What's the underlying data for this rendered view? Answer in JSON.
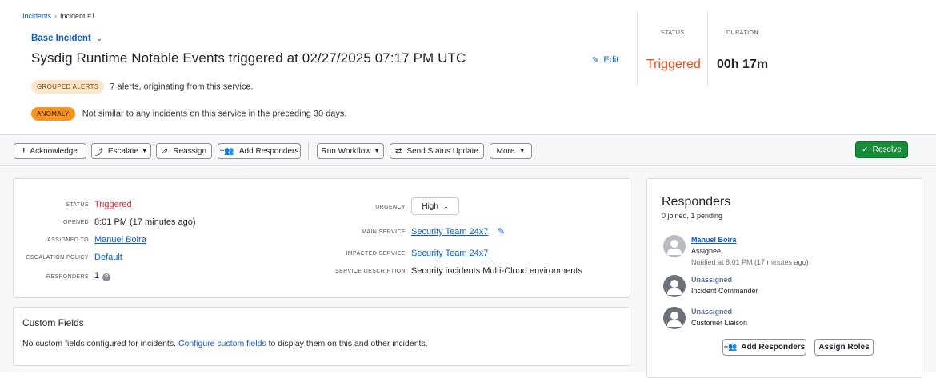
{
  "breadcrumb": {
    "root": "Incidents",
    "separator": "›",
    "current": "Incident #1"
  },
  "header": {
    "base_incident": "Base Incident",
    "title": "Sysdig Runtime Notable Events triggered at 02/27/2025 07:17 PM UTC",
    "edit_label": "Edit",
    "grouped_pill": "GROUPED ALERTS",
    "grouped_text": "7 alerts, originating from this service.",
    "anomaly_pill": "ANOMALY",
    "anomaly_text": "Not similar to any incidents on this service in the preceding 30 days.",
    "status_label": "STATUS",
    "status_value": "Triggered",
    "duration_label": "DURATION",
    "duration_value": "00h 17m"
  },
  "toolbar": {
    "acknowledge": "Acknowledge",
    "escalate": "Escalate",
    "reassign": "Reassign",
    "add_responders": "Add Responders",
    "run_workflow": "Run Workflow",
    "send_status_update": "Send Status Update",
    "more": "More",
    "resolve": "Resolve"
  },
  "details": {
    "status_label": "STATUS",
    "status_value": "Triggered",
    "opened_label": "OPENED",
    "opened_value": "8:01 PM (17 minutes ago)",
    "assigned_label": "ASSIGNED TO",
    "assigned_value": "Manuel Boira",
    "escalation_label": "ESCALATION POLICY",
    "escalation_value": "Default",
    "responders_label": "RESPONDERS",
    "responders_value": "1",
    "urgency_label": "URGENCY",
    "urgency_value": "High",
    "main_service_label": "MAIN SERVICE",
    "main_service_value": "Security Team 24x7",
    "impacted_label": "IMPACTED SERVICE",
    "impacted_value": "Security Team 24x7",
    "description_label": "SERVICE DESCRIPTION",
    "description_value": "Security incidents Multi-Cloud environments"
  },
  "custom_fields": {
    "title": "Custom Fields",
    "text_before": "No custom fields configured for incidents.",
    "link": "Configure custom fields",
    "text_after": "to display them on this and other incidents."
  },
  "responders": {
    "title": "Responders",
    "summary": "0 joined, 1 pending",
    "items": [
      {
        "name": "Manuel Boira",
        "role": "Assignee",
        "note": "Notified at 8:01 PM (17 minutes ago)"
      },
      {
        "name": "Unassigned",
        "role": "Incident Commander",
        "note": ""
      },
      {
        "name": "Unassigned",
        "role": "Customer Liaison",
        "note": ""
      }
    ],
    "add_button": "Add Responders",
    "assign_button": "Assign Roles"
  },
  "colors": {
    "link": "#0b5cd5",
    "triggered_header": "#e64a19",
    "triggered_detail": "#e5242b",
    "resolve": "#158c38",
    "anomaly": "#f7941d",
    "grouped": "#fde6c9"
  }
}
